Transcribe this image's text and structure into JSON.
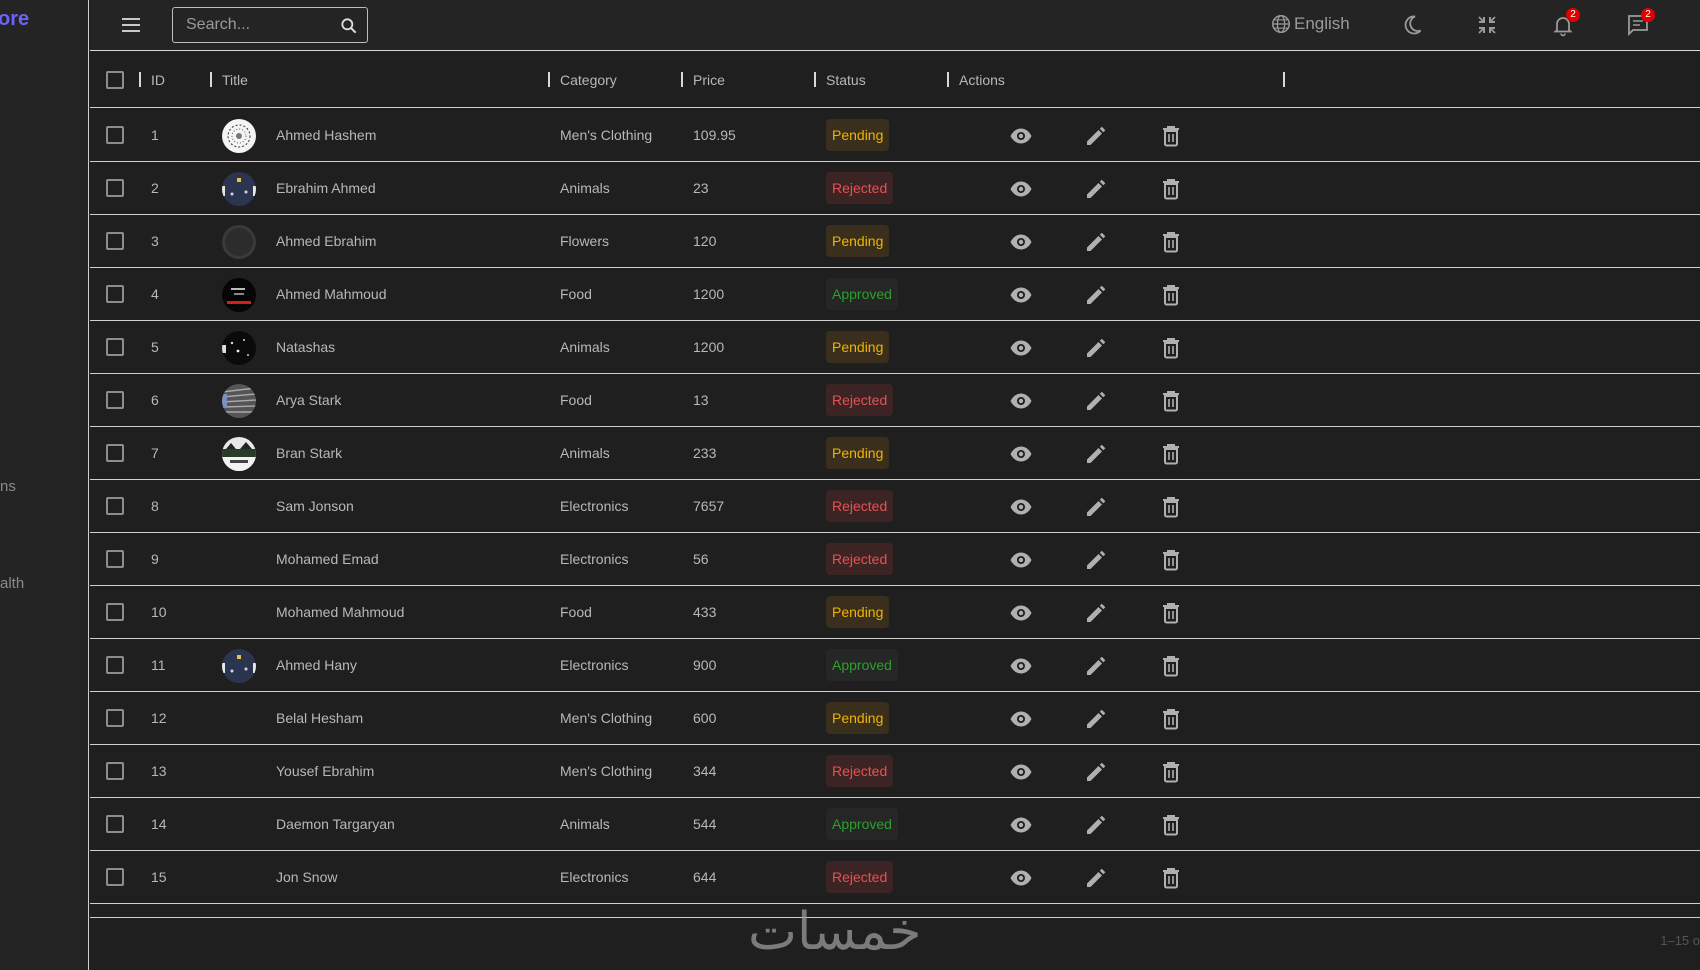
{
  "sidebar": {
    "brand": "ore",
    "fragments": [
      "ns",
      "alth"
    ]
  },
  "header": {
    "search_placeholder": "Search...",
    "language": "English",
    "notifications_count": "2",
    "messages_count": "2"
  },
  "table": {
    "columns": {
      "id": "ID",
      "title": "Title",
      "category": "Category",
      "price": "Price",
      "status": "Status",
      "actions": "Actions"
    },
    "rows": [
      {
        "id": "1",
        "title": "Ahmed Hashem",
        "category": "Men's Clothing",
        "price": "109.95",
        "status": "Pending",
        "avatar": "white"
      },
      {
        "id": "2",
        "title": "Ebrahim Ahmed",
        "category": "Animals",
        "price": "23",
        "status": "Rejected",
        "avatar": "navy"
      },
      {
        "id": "3",
        "title": "Ahmed Ebrahim",
        "category": "Flowers",
        "price": "120",
        "status": "Pending",
        "avatar": "dark"
      },
      {
        "id": "4",
        "title": "Ahmed Mahmoud",
        "category": "Food",
        "price": "1200",
        "status": "Approved",
        "avatar": "black-red"
      },
      {
        "id": "5",
        "title": "Natashas",
        "category": "Animals",
        "price": "1200",
        "status": "Pending",
        "avatar": "black"
      },
      {
        "id": "6",
        "title": "Arya Stark",
        "category": "Food",
        "price": "13",
        "status": "Rejected",
        "avatar": "striped"
      },
      {
        "id": "7",
        "title": "Bran Stark",
        "category": "Animals",
        "price": "233",
        "status": "Pending",
        "avatar": "landscape"
      },
      {
        "id": "8",
        "title": "Sam Jonson",
        "category": "Electronics",
        "price": "7657",
        "status": "Rejected",
        "avatar": ""
      },
      {
        "id": "9",
        "title": "Mohamed Emad",
        "category": "Electronics",
        "price": "56",
        "status": "Rejected",
        "avatar": ""
      },
      {
        "id": "10",
        "title": "Mohamed Mahmoud",
        "category": "Food",
        "price": "433",
        "status": "Pending",
        "avatar": ""
      },
      {
        "id": "11",
        "title": "Ahmed Hany",
        "category": "Electronics",
        "price": "900",
        "status": "Approved",
        "avatar": "navy"
      },
      {
        "id": "12",
        "title": "Belal Hesham",
        "category": "Men's Clothing",
        "price": "600",
        "status": "Pending",
        "avatar": ""
      },
      {
        "id": "13",
        "title": "Yousef Ebrahim",
        "category": "Men's Clothing",
        "price": "344",
        "status": "Rejected",
        "avatar": ""
      },
      {
        "id": "14",
        "title": "Daemon Targaryan",
        "category": "Animals",
        "price": "544",
        "status": "Approved",
        "avatar": ""
      },
      {
        "id": "15",
        "title": "Jon Snow",
        "category": "Electronics",
        "price": "644",
        "status": "Rejected",
        "avatar": ""
      }
    ]
  },
  "footer": {
    "pagination": "1–15 o",
    "watermark": "خمسات"
  },
  "colors": {
    "pending": "#f0b400",
    "rejected": "#e85050",
    "approved": "#2aa12a",
    "brand": "#6c63ff"
  }
}
